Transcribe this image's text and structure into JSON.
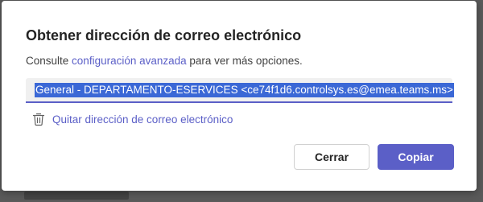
{
  "dialog": {
    "title": "Obtener dirección de correo electrónico",
    "subtitle_prefix": "Consulte ",
    "subtitle_link": "configuración avanzada",
    "subtitle_suffix": " para ver más opciones.",
    "email_value": "General - DEPARTAMENTO-ESERVICES <ce74f1d6.controlsys.es@emea.teams.ms>",
    "remove_label": "Quitar dirección de correo electrónico",
    "cancel_label": "Cerrar",
    "copy_label": "Copiar"
  },
  "colors": {
    "accent": "#5b5fc7",
    "selection": "#3b68d6"
  },
  "icons": {
    "remove": "trash-icon"
  }
}
